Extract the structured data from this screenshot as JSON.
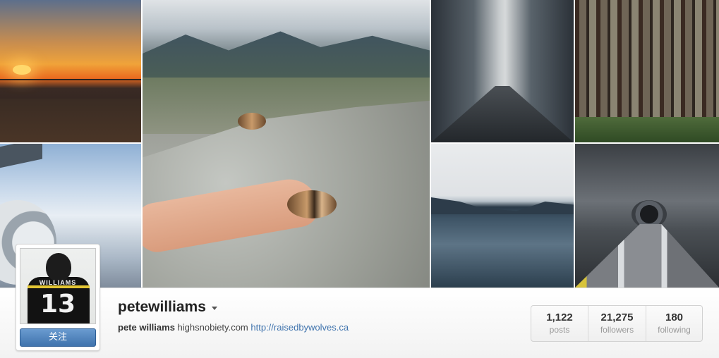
{
  "photos": [
    {
      "name": "sunset-rooftop-photo"
    },
    {
      "name": "airplane-wing-photo"
    },
    {
      "name": "chipmunk-rock-photo"
    },
    {
      "name": "reflective-hallway-photo"
    },
    {
      "name": "forest-photo"
    },
    {
      "name": "lake-photo"
    },
    {
      "name": "tunnel-photo"
    }
  ],
  "avatar": {
    "jersey_name": "WILLIAMS",
    "jersey_number": "13"
  },
  "profile": {
    "username": "petewilliams",
    "full_name": "pete williams",
    "bio_text": "highsnobiety.com",
    "website": "http://raisedbywolves.ca",
    "follow_label": "关注"
  },
  "stats": {
    "posts": {
      "value": "1,122",
      "label": "posts"
    },
    "followers": {
      "value": "21,275",
      "label": "followers"
    },
    "following": {
      "value": "180",
      "label": "following"
    }
  },
  "colors": {
    "follow_button": "#3f73ad",
    "link": "#3f73ad"
  }
}
